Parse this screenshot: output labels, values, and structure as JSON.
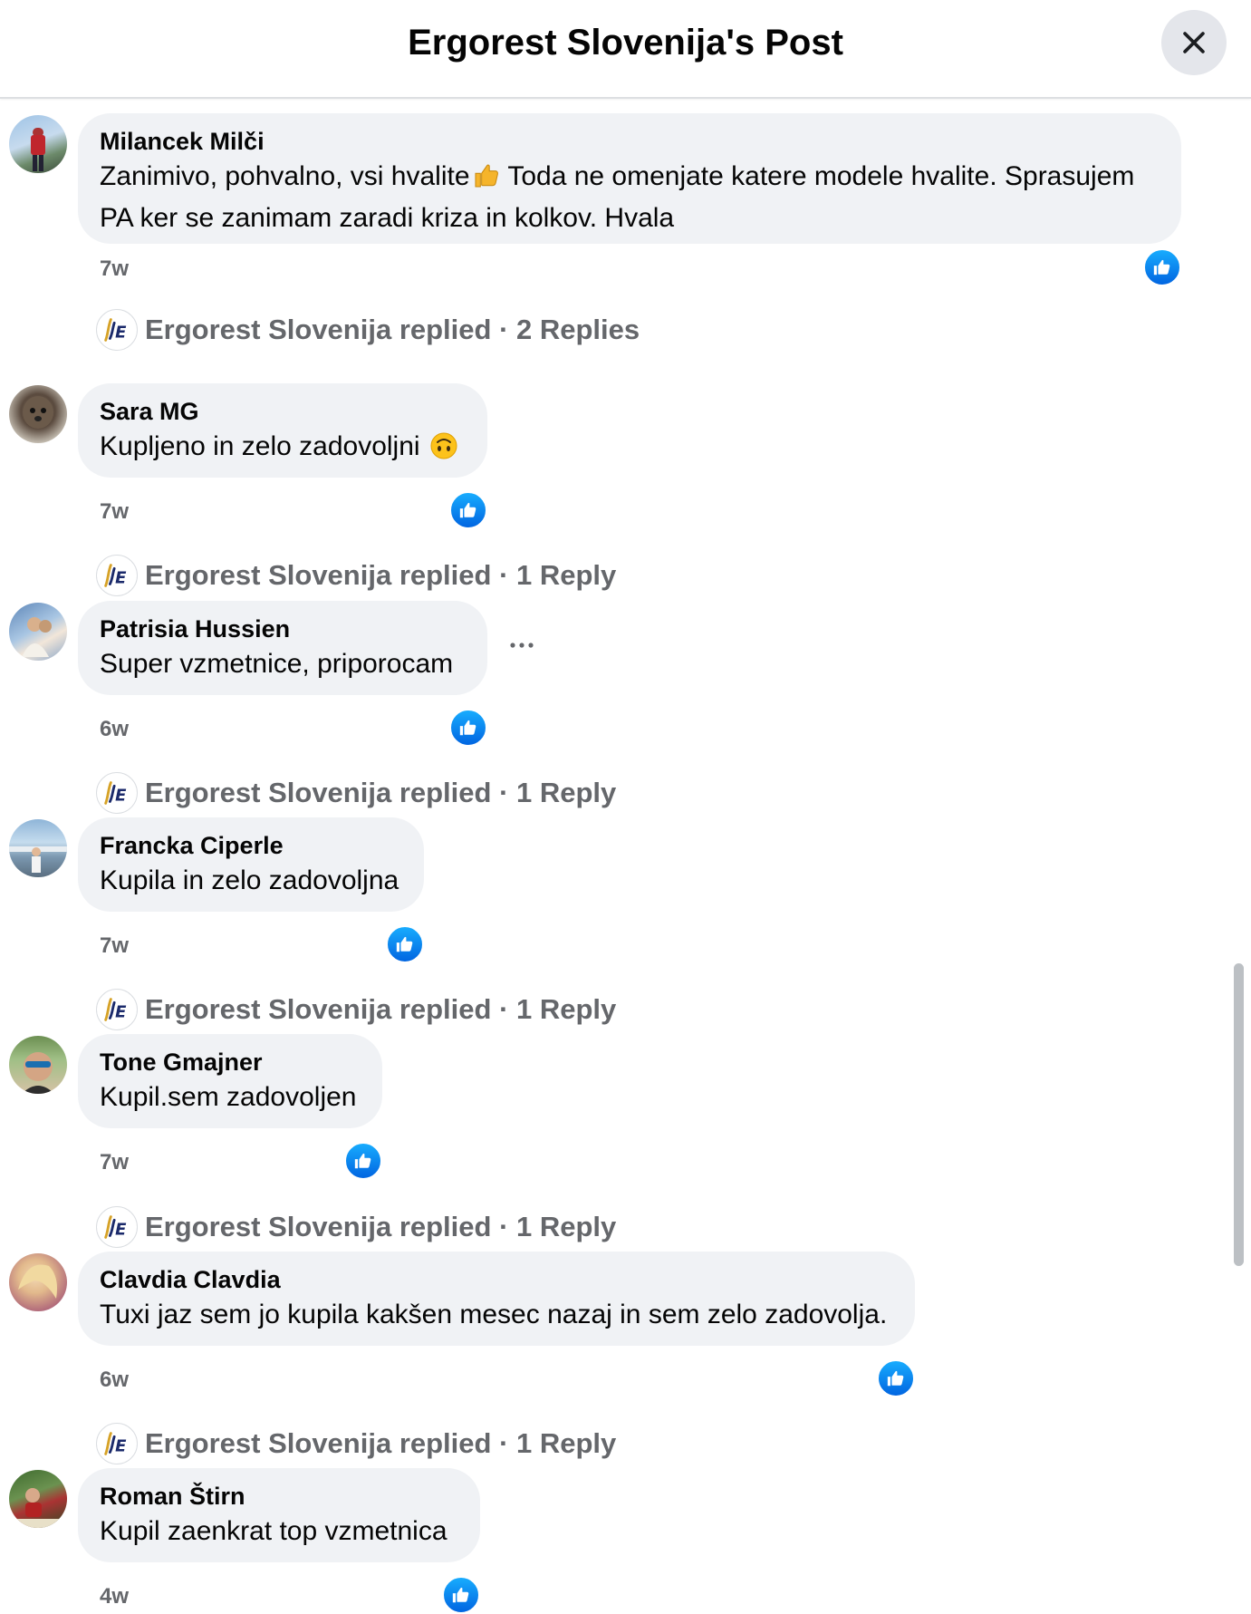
{
  "header": {
    "title": "Ergorest Slovenija's Post",
    "close_icon": "close-icon"
  },
  "comments": [
    {
      "author": "Milancek Milči",
      "text_part1": "Zanimivo, pohvalno, vsi hvalite",
      "emoji": "thumbs-up-emoji",
      "text_part2": " Toda ne omenjate katere modele hvalite. Sprasujem PA ker se zanimam zaradi kriza in kolkov. Hvala",
      "time": "7w",
      "reaction_icon": "like-reaction-icon",
      "replies_summary": "Ergorest Slovenija replied · 2 Replies"
    },
    {
      "author": "Sara MG",
      "text": "Kupljeno in zelo zadovoljni",
      "emoji": "upside-down-face-emoji",
      "time": "7w",
      "reaction_icon": "like-reaction-icon",
      "replies_summary": "Ergorest Slovenija replied · 1 Reply"
    },
    {
      "author": "Patrisia Hussien",
      "text": "Super vzmetnice, priporocam",
      "more_icon": "more-options-icon",
      "time": "6w",
      "reaction_icon": "like-reaction-icon",
      "replies_summary": "Ergorest Slovenija replied · 1 Reply"
    },
    {
      "author": "Francka Ciperle",
      "text": "Kupila in zelo zadovoljna",
      "time": "7w",
      "reaction_icon": "like-reaction-icon",
      "replies_summary": "Ergorest Slovenija replied · 1 Reply"
    },
    {
      "author": "Tone Gmajner",
      "text": "Kupil.sem zadovoljen",
      "time": "7w",
      "reaction_icon": "like-reaction-icon",
      "replies_summary": "Ergorest Slovenija replied · 1 Reply"
    },
    {
      "author": "Clavdia Clavdia",
      "text": "Tuxi jaz sem jo kupila kakšen mesec nazaj in sem zelo zadovolja.",
      "time": "6w",
      "reaction_icon": "like-reaction-icon",
      "replies_summary": "Ergorest Slovenija replied · 1 Reply"
    },
    {
      "author": "Roman Štirn",
      "text": "Kupil zaenkrat top vzmetnica",
      "time": "4w",
      "reaction_icon": "like-reaction-icon"
    }
  ],
  "colors": {
    "bubble_bg": "#f0f2f5",
    "secondary_text": "#65676b",
    "like_blue": "#0866ff",
    "brand_navy": "#1b2a6b",
    "brand_gold": "#d6a227"
  }
}
